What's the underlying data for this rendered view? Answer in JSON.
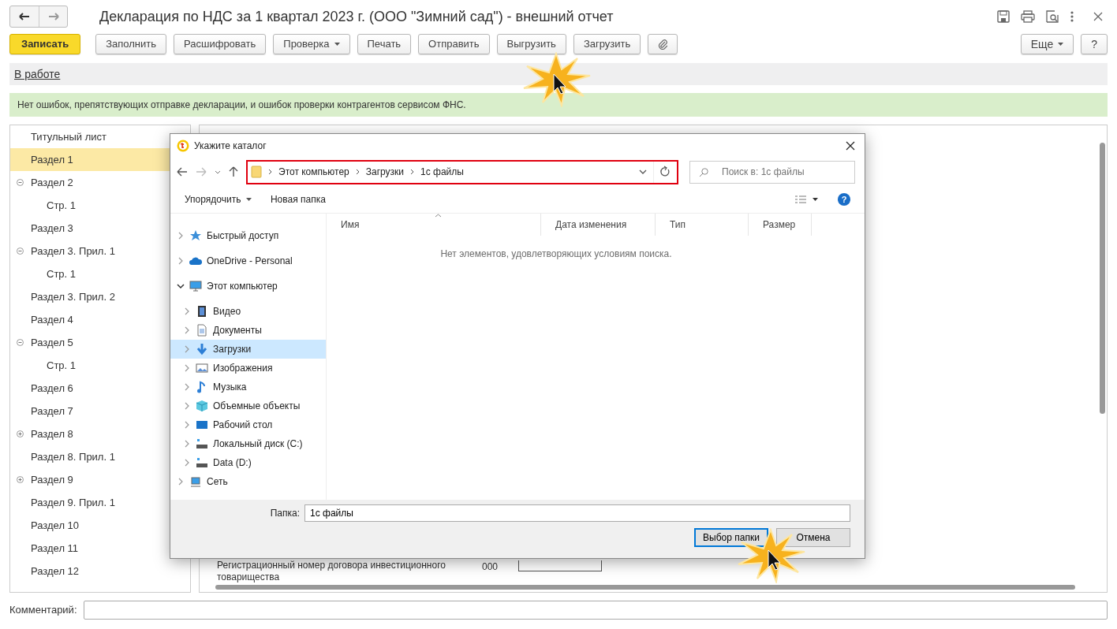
{
  "window": {
    "title": "Декларация по НДС за 1 квартал 2023 г. (ООО \"Зимний сад\") - внешний отчет",
    "status": "В работе"
  },
  "toolbar": {
    "buttons": [
      {
        "label": "Записать",
        "kind": "primary"
      },
      {
        "label": "Заполнить",
        "kind": "plain"
      },
      {
        "label": "Расшифровать",
        "kind": "plain"
      },
      {
        "label": "Проверка",
        "kind": "dropdown"
      },
      {
        "label": "Печать",
        "kind": "plain"
      },
      {
        "label": "Отправить",
        "kind": "plain"
      },
      {
        "label": "Выгрузить",
        "kind": "plain"
      },
      {
        "label": "Загрузить",
        "kind": "plain"
      },
      {
        "kind": "attach"
      }
    ],
    "right_buttons": [
      {
        "label": "Еще",
        "kind": "dropdown"
      },
      {
        "label": "?",
        "kind": "plain"
      }
    ]
  },
  "message": "Нет ошибок, препятствующих отправке декларации, и ошибок проверки контрагентов сервисом ФНС.",
  "sections": [
    {
      "label": "Титульный лист",
      "selected": false
    },
    {
      "label": "Раздел 1",
      "selected": true
    },
    {
      "label": "Раздел 2",
      "selected": false,
      "expanded": true,
      "children": [
        {
          "label": "Стр. 1",
          "selected": false
        }
      ]
    },
    {
      "label": "Раздел 3",
      "selected": false
    },
    {
      "label": "Раздел 3. Прил. 1",
      "selected": false,
      "expanded": true,
      "children": [
        {
          "label": "Стр. 1",
          "selected": false
        }
      ]
    },
    {
      "label": "Раздел 3. Прил. 2",
      "selected": false
    },
    {
      "label": "Раздел 4",
      "selected": false
    },
    {
      "label": "Раздел 5",
      "selected": false,
      "expanded": true,
      "children": [
        {
          "label": "Стр. 1",
          "selected": false
        }
      ]
    },
    {
      "label": "Раздел 6",
      "selected": false
    },
    {
      "label": "Раздел 7",
      "selected": false
    },
    {
      "label": "Раздел 8",
      "selected": false,
      "expanded": false
    },
    {
      "label": "Раздел 8. Прил. 1",
      "selected": false
    },
    {
      "label": "Раздел 9",
      "selected": false,
      "expanded": false
    },
    {
      "label": "Раздел 9. Прил. 1",
      "selected": false
    },
    {
      "label": "Раздел 10",
      "selected": false
    },
    {
      "label": "Раздел 11",
      "selected": false
    },
    {
      "label": "Раздел 12",
      "selected": false
    }
  ],
  "form_fragment": {
    "text": "Регистрационный номер договора инвестиционного товарищества",
    "code": "000"
  },
  "comment": {
    "label": "Комментарий:"
  },
  "dialog": {
    "title": "Укажите каталог",
    "path": [
      "Этот компьютер",
      "Загрузки",
      "1с файлы"
    ],
    "search_placeholder": "Поиск в: 1с файлы",
    "commands": [
      {
        "label": "Упорядочить",
        "kind": "dropdown"
      },
      {
        "label": "Новая папка",
        "kind": "plain"
      }
    ],
    "nav": [
      {
        "label": "Быстрый доступ",
        "kind": "star",
        "selected": false,
        "expanded": false
      },
      {
        "label": "OneDrive - Personal",
        "kind": "cloud",
        "selected": false,
        "expanded": false
      },
      {
        "label": "Этот компьютер",
        "kind": "computer",
        "selected": false,
        "expanded": true,
        "children": [
          {
            "label": "Видео",
            "kind": "film",
            "selected": false
          },
          {
            "label": "Документы",
            "kind": "document",
            "selected": false
          },
          {
            "label": "Загрузки",
            "kind": "download",
            "selected": true
          },
          {
            "label": "Изображения",
            "kind": "picture",
            "selected": false
          },
          {
            "label": "Музыка",
            "kind": "note",
            "selected": false
          },
          {
            "label": "Объемные объекты",
            "kind": "cube",
            "selected": false
          },
          {
            "label": "Рабочий стол",
            "kind": "desktop",
            "selected": false
          },
          {
            "label": "Локальный диск (C:)",
            "kind": "drive",
            "selected": false
          },
          {
            "label": "Data (D:)",
            "kind": "drive",
            "selected": false
          }
        ]
      },
      {
        "label": "Сеть",
        "kind": "network",
        "selected": false,
        "expanded": false
      }
    ],
    "help_label": "?",
    "columns": [
      "Имя",
      "Дата изменения",
      "Тип",
      "Размер"
    ],
    "empty_message": "Нет элементов, удовлетворяющих условиям поиска.",
    "folder_label": "Папка:",
    "folder_value": "1с файлы",
    "buttons": [
      {
        "label": "Выбор папки",
        "kind": "default"
      },
      {
        "label": "Отмена",
        "kind": "plain"
      }
    ]
  }
}
